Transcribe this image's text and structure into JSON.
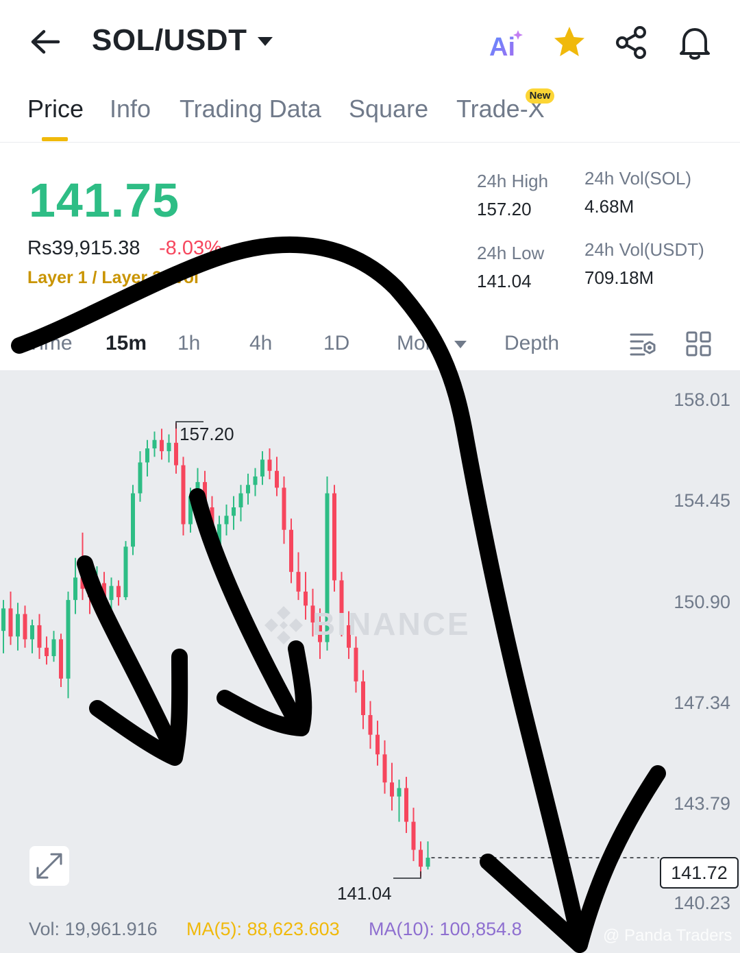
{
  "header": {
    "pair": "SOL/USDT",
    "icons": [
      "back-arrow-icon",
      "caret-down-icon",
      "ai-icon",
      "star-icon",
      "share-icon",
      "bell-icon"
    ],
    "ai_label": "Ai"
  },
  "tabs": [
    {
      "label": "Price",
      "active": true
    },
    {
      "label": "Info"
    },
    {
      "label": "Trading Data"
    },
    {
      "label": "Square"
    },
    {
      "label": "Trade-X",
      "badge": "New"
    }
  ],
  "ticker": {
    "last_price": "141.75",
    "fiat_price": "Rs39,915.38",
    "change_pct": "-8.03%",
    "category": "Layer 1 / Layer 2",
    "vol_tag": "Vol",
    "high_label": "24h High",
    "high_value": "157.20",
    "low_label": "24h Low",
    "low_value": "141.04",
    "vol_base_label": "24h Vol(SOL)",
    "vol_base_value": "4.68M",
    "vol_quote_label": "24h Vol(USDT)",
    "vol_quote_value": "709.18M"
  },
  "intervals": {
    "items": [
      "Time",
      "15m",
      "1h",
      "4h",
      "1D",
      "More",
      "Depth"
    ],
    "active": "15m"
  },
  "chart_data": {
    "type": "candlestick",
    "pair": "SOL/USDT",
    "interval": "15m",
    "y_ticks": [
      "158.01",
      "154.45",
      "150.90",
      "147.34",
      "143.79",
      "140.23"
    ],
    "ylim": [
      140.23,
      158.01
    ],
    "annotations": {
      "high": "157.20",
      "low": "141.04"
    },
    "current_price_tag": "141.72",
    "current_price": 141.72,
    "colors": {
      "up": "#2ebd85",
      "down": "#f6465d"
    },
    "candles": [
      {
        "o": 149.8,
        "h": 150.9,
        "l": 149.0,
        "c": 150.6
      },
      {
        "o": 150.6,
        "h": 151.2,
        "l": 149.3,
        "c": 149.6
      },
      {
        "o": 149.6,
        "h": 150.8,
        "l": 149.1,
        "c": 150.4
      },
      {
        "o": 150.4,
        "h": 150.7,
        "l": 149.2,
        "c": 149.5
      },
      {
        "o": 149.5,
        "h": 150.2,
        "l": 149.0,
        "c": 150.0
      },
      {
        "o": 150.0,
        "h": 150.4,
        "l": 148.8,
        "c": 149.2
      },
      {
        "o": 149.2,
        "h": 149.6,
        "l": 148.6,
        "c": 148.9
      },
      {
        "o": 148.9,
        "h": 149.8,
        "l": 148.7,
        "c": 149.5
      },
      {
        "o": 149.5,
        "h": 149.7,
        "l": 147.8,
        "c": 148.1
      },
      {
        "o": 148.1,
        "h": 151.2,
        "l": 147.4,
        "c": 150.9
      },
      {
        "o": 150.9,
        "h": 152.4,
        "l": 150.4,
        "c": 151.7
      },
      {
        "o": 151.7,
        "h": 153.3,
        "l": 150.9,
        "c": 151.3
      },
      {
        "o": 151.3,
        "h": 151.6,
        "l": 150.4,
        "c": 151.0
      },
      {
        "o": 151.0,
        "h": 152.1,
        "l": 150.6,
        "c": 151.5
      },
      {
        "o": 151.5,
        "h": 151.9,
        "l": 150.6,
        "c": 150.9
      },
      {
        "o": 150.9,
        "h": 151.7,
        "l": 150.5,
        "c": 151.4
      },
      {
        "o": 151.4,
        "h": 151.6,
        "l": 150.7,
        "c": 151.0
      },
      {
        "o": 151.0,
        "h": 153.0,
        "l": 150.9,
        "c": 152.8
      },
      {
        "o": 152.8,
        "h": 155.0,
        "l": 152.5,
        "c": 154.7
      },
      {
        "o": 154.7,
        "h": 156.2,
        "l": 154.4,
        "c": 155.8
      },
      {
        "o": 155.8,
        "h": 156.6,
        "l": 155.3,
        "c": 156.3
      },
      {
        "o": 156.3,
        "h": 156.9,
        "l": 156.0,
        "c": 156.6
      },
      {
        "o": 156.6,
        "h": 157.0,
        "l": 155.9,
        "c": 156.2
      },
      {
        "o": 156.2,
        "h": 156.8,
        "l": 155.8,
        "c": 156.5
      },
      {
        "o": 156.5,
        "h": 157.2,
        "l": 155.4,
        "c": 155.7
      },
      {
        "o": 155.7,
        "h": 156.0,
        "l": 153.2,
        "c": 153.6
      },
      {
        "o": 153.6,
        "h": 154.9,
        "l": 153.3,
        "c": 154.6
      },
      {
        "o": 154.6,
        "h": 155.6,
        "l": 154.2,
        "c": 155.1
      },
      {
        "o": 155.1,
        "h": 155.5,
        "l": 153.9,
        "c": 154.2
      },
      {
        "o": 154.2,
        "h": 154.6,
        "l": 152.3,
        "c": 152.8
      },
      {
        "o": 152.8,
        "h": 153.9,
        "l": 152.3,
        "c": 153.6
      },
      {
        "o": 153.6,
        "h": 154.3,
        "l": 153.2,
        "c": 153.9
      },
      {
        "o": 153.9,
        "h": 154.6,
        "l": 153.4,
        "c": 154.2
      },
      {
        "o": 154.2,
        "h": 155.0,
        "l": 153.7,
        "c": 154.7
      },
      {
        "o": 154.7,
        "h": 155.4,
        "l": 154.3,
        "c": 155.0
      },
      {
        "o": 155.0,
        "h": 155.6,
        "l": 154.6,
        "c": 155.3
      },
      {
        "o": 155.3,
        "h": 156.2,
        "l": 155.0,
        "c": 155.9
      },
      {
        "o": 155.9,
        "h": 156.3,
        "l": 155.2,
        "c": 155.5
      },
      {
        "o": 155.5,
        "h": 156.0,
        "l": 154.6,
        "c": 154.9
      },
      {
        "o": 154.9,
        "h": 155.3,
        "l": 152.9,
        "c": 153.4
      },
      {
        "o": 153.4,
        "h": 153.8,
        "l": 151.5,
        "c": 151.9
      },
      {
        "o": 151.9,
        "h": 152.6,
        "l": 150.9,
        "c": 151.2
      },
      {
        "o": 151.2,
        "h": 151.9,
        "l": 150.2,
        "c": 150.7
      },
      {
        "o": 150.7,
        "h": 151.3,
        "l": 149.6,
        "c": 150.1
      },
      {
        "o": 150.1,
        "h": 150.6,
        "l": 148.8,
        "c": 149.4
      },
      {
        "o": 149.4,
        "h": 155.3,
        "l": 149.1,
        "c": 154.7
      },
      {
        "o": 154.7,
        "h": 155.0,
        "l": 151.2,
        "c": 151.6
      },
      {
        "o": 151.6,
        "h": 151.9,
        "l": 149.6,
        "c": 150.0
      },
      {
        "o": 150.0,
        "h": 150.5,
        "l": 148.8,
        "c": 149.2
      },
      {
        "o": 149.2,
        "h": 149.6,
        "l": 147.6,
        "c": 148.0
      },
      {
        "o": 148.0,
        "h": 148.4,
        "l": 146.3,
        "c": 146.8
      },
      {
        "o": 146.8,
        "h": 147.3,
        "l": 145.6,
        "c": 146.1
      },
      {
        "o": 146.1,
        "h": 146.6,
        "l": 145.0,
        "c": 145.4
      },
      {
        "o": 145.4,
        "h": 145.9,
        "l": 144.0,
        "c": 144.4
      },
      {
        "o": 144.4,
        "h": 145.1,
        "l": 143.4,
        "c": 143.9
      },
      {
        "o": 143.9,
        "h": 144.5,
        "l": 143.0,
        "c": 144.2
      },
      {
        "o": 144.2,
        "h": 144.6,
        "l": 142.6,
        "c": 143.0
      },
      {
        "o": 143.0,
        "h": 143.5,
        "l": 141.6,
        "c": 142.0
      },
      {
        "o": 142.0,
        "h": 142.3,
        "l": 141.04,
        "c": 141.4
      },
      {
        "o": 141.4,
        "h": 142.3,
        "l": 141.3,
        "c": 141.72
      }
    ]
  },
  "volume_bar": {
    "vol_label": "Vol: 19,961.916",
    "ma5_label": "MA(5): 88,623.603",
    "ma10_label": "MA(10): 100,854.8",
    "colors": {
      "vol": "#707a8a",
      "ma5": "#f0b90b",
      "ma10": "#8e6fd0"
    }
  },
  "watermark": {
    "text": "BINANCE"
  },
  "credit": "@ Panda Traders"
}
